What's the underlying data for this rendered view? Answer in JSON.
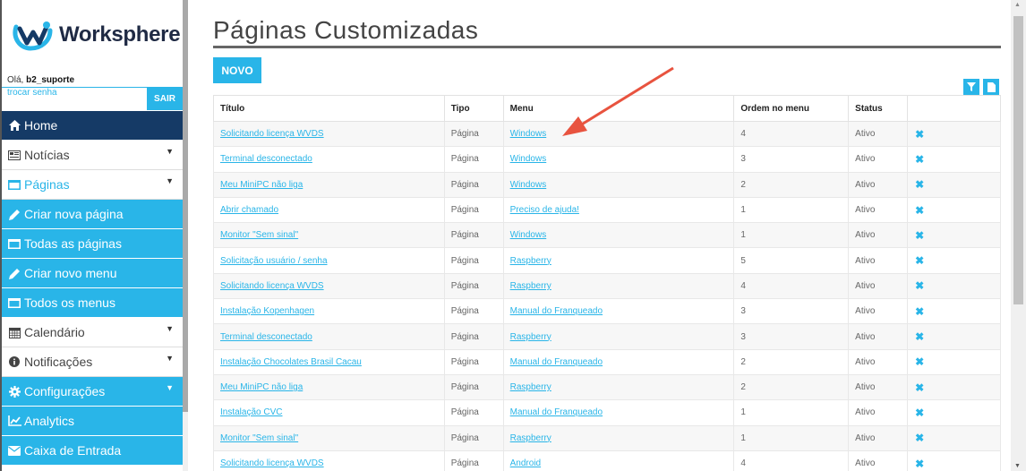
{
  "brand": {
    "name": "Worksphere"
  },
  "user": {
    "greeting": "Olá,",
    "username": "b2_suporte",
    "change_password": "trocar senha",
    "logout": "SAIR"
  },
  "menu": [
    {
      "label": "Home",
      "icon": "home-icon",
      "style": "dark",
      "caret": false
    },
    {
      "label": "Notícias",
      "icon": "newspaper-icon",
      "style": "light",
      "caret": true
    },
    {
      "label": "Páginas",
      "icon": "window-icon",
      "style": "active",
      "caret": true
    },
    {
      "label": "Criar nova página",
      "icon": "pencil-icon",
      "style": "blue",
      "caret": false
    },
    {
      "label": "Todas as páginas",
      "icon": "window-icon",
      "style": "blue",
      "caret": false
    },
    {
      "label": "Criar novo menu",
      "icon": "pencil-icon",
      "style": "blue",
      "caret": false
    },
    {
      "label": "Todos os menus",
      "icon": "window-icon",
      "style": "blue",
      "caret": false
    },
    {
      "label": "Calendário",
      "icon": "calendar-icon",
      "style": "light",
      "caret": true
    },
    {
      "label": "Notificações",
      "icon": "info-icon",
      "style": "light",
      "caret": true
    },
    {
      "label": "Configurações",
      "icon": "gear-icon",
      "style": "blue",
      "caret": true
    },
    {
      "label": "Analytics",
      "icon": "chart-icon",
      "style": "blue",
      "caret": false
    },
    {
      "label": "Caixa de Entrada",
      "icon": "envelope-icon",
      "style": "blue",
      "caret": false
    }
  ],
  "page": {
    "title": "Páginas Customizadas",
    "new_button": "NOVO",
    "filter_icon": "filter-icon",
    "export_icon": "document-icon"
  },
  "table": {
    "headers": [
      "Título",
      "Tipo",
      "Menu",
      "Ordem no menu",
      "Status",
      ""
    ],
    "rows": [
      {
        "title": "Solicitando licença WVDS",
        "type": "Página",
        "menu": "Windows",
        "order": "4",
        "status": "Ativo"
      },
      {
        "title": "Terminal desconectado",
        "type": "Página",
        "menu": "Windows",
        "order": "3",
        "status": "Ativo"
      },
      {
        "title": "Meu MiniPC não liga",
        "type": "Página",
        "menu": "Windows",
        "order": "2",
        "status": "Ativo"
      },
      {
        "title": "Abrir chamado",
        "type": "Página",
        "menu": "Preciso de ajuda!",
        "order": "1",
        "status": "Ativo"
      },
      {
        "title": "Monitor \"Sem sinal\"",
        "type": "Página",
        "menu": "Windows",
        "order": "1",
        "status": "Ativo"
      },
      {
        "title": "Solicitação usuário / senha",
        "type": "Página",
        "menu": "Raspberry",
        "order": "5",
        "status": "Ativo"
      },
      {
        "title": "Solicitando licença WVDS",
        "type": "Página",
        "menu": "Raspberry",
        "order": "4",
        "status": "Ativo"
      },
      {
        "title": "Instalação Kopenhagen",
        "type": "Página",
        "menu": "Manual do Franqueado",
        "order": "3",
        "status": "Ativo"
      },
      {
        "title": "Terminal desconectado",
        "type": "Página",
        "menu": "Raspberry",
        "order": "3",
        "status": "Ativo"
      },
      {
        "title": "Instalação Chocolates Brasil Cacau",
        "type": "Página",
        "menu": "Manual do Franqueado",
        "order": "2",
        "status": "Ativo"
      },
      {
        "title": "Meu MiniPC não liga",
        "type": "Página",
        "menu": "Raspberry",
        "order": "2",
        "status": "Ativo"
      },
      {
        "title": "Instalação CVC",
        "type": "Página",
        "menu": "Manual do Franqueado",
        "order": "1",
        "status": "Ativo"
      },
      {
        "title": "Monitor \"Sem sinal\"",
        "type": "Página",
        "menu": "Raspberry",
        "order": "1",
        "status": "Ativo"
      },
      {
        "title": "Solicitando licença WVDS",
        "type": "Página",
        "menu": "Android",
        "order": "4",
        "status": "Ativo"
      }
    ],
    "delete_glyph": "✖"
  },
  "colors": {
    "accent": "#29b5e8",
    "navy": "#153a66",
    "annotation": "#e8533f"
  }
}
